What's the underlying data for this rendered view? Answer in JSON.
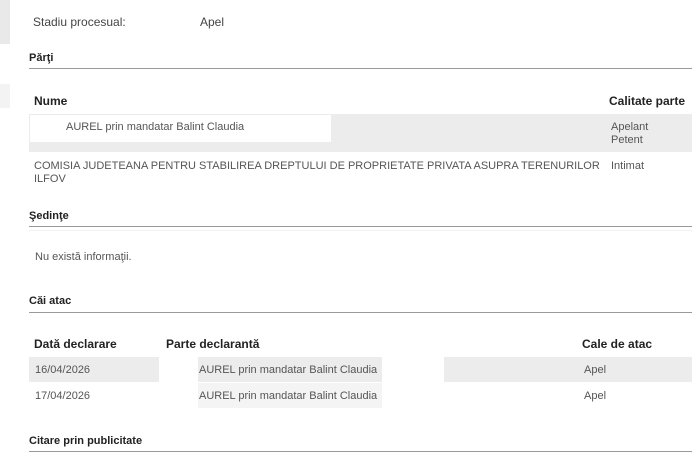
{
  "top": {
    "label": "Stadiu procesual:",
    "value": "Apel"
  },
  "parti": {
    "title": "Părţi",
    "headers": {
      "name": "Nume",
      "quality": "Calitate parte"
    },
    "rows": [
      {
        "name": "AUREL prin mandatar Balint Claudia",
        "quality_1": "Apelant",
        "quality_2": "Petent"
      },
      {
        "name_line1": "COMISIA JUDETEANA PENTRU STABILIREA DREPTULUI DE PROPRIETATE PRIVATA ASUPRA TERENURILOR",
        "name_line2": "ILFOV",
        "quality_1": "Intimat"
      }
    ]
  },
  "sedinte": {
    "title": "Şedinţe",
    "empty": "Nu există informaţii."
  },
  "cai_atac": {
    "title": "Căi atac",
    "headers": {
      "date": "Dată declarare",
      "party": "Parte declarantă",
      "path": "Cale de atac"
    },
    "rows": [
      {
        "date": "16/04/2026",
        "party": "AUREL prin mandatar Balint Claudia",
        "path": "Apel"
      },
      {
        "date": "17/04/2026",
        "party": "AUREL prin mandatar Balint Claudia",
        "path": "Apel"
      }
    ]
  },
  "citare": {
    "title": "Citare prin publicitate"
  }
}
